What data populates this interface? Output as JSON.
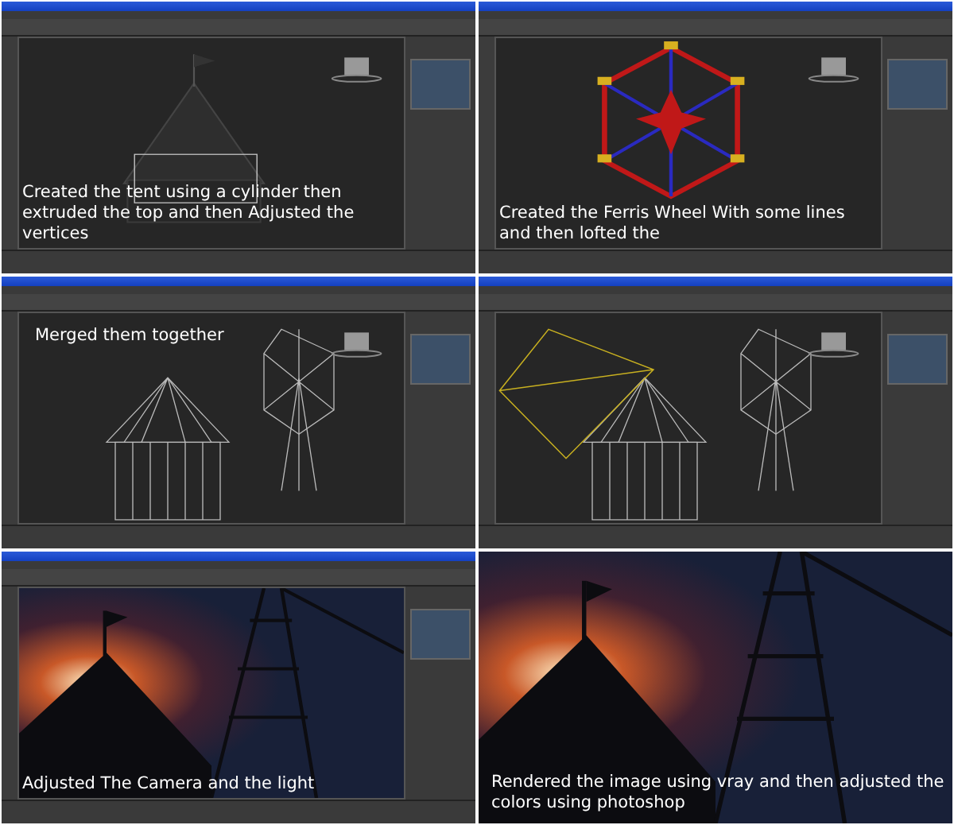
{
  "panels": [
    {
      "kind": "editor",
      "viewport": {
        "kind": "tent"
      },
      "caption": {
        "kind": "bottom",
        "text": "Created the tent using a cylinder then extruded the top and then Adjusted the vertices"
      }
    },
    {
      "kind": "editor",
      "viewport": {
        "kind": "wheel"
      },
      "caption": {
        "kind": "bottom",
        "text": "Created the Ferris Wheel With some lines and then lofted the"
      }
    },
    {
      "kind": "editor",
      "viewport": {
        "kind": "wireframe"
      },
      "caption": {
        "kind": "top",
        "text": "Merged them together"
      }
    },
    {
      "kind": "editor",
      "viewport": {
        "kind": "camera"
      }
    },
    {
      "kind": "editor",
      "viewport": {
        "kind": "sunset"
      },
      "caption": {
        "kind": "bottom",
        "text": "Adjusted The Camera and the light"
      }
    },
    {
      "kind": "render",
      "viewport": {
        "kind": "sunset"
      },
      "caption": {
        "kind": "bottom",
        "text": "Rendered the image using vray and then adjusted the colors using photoshop"
      }
    }
  ]
}
